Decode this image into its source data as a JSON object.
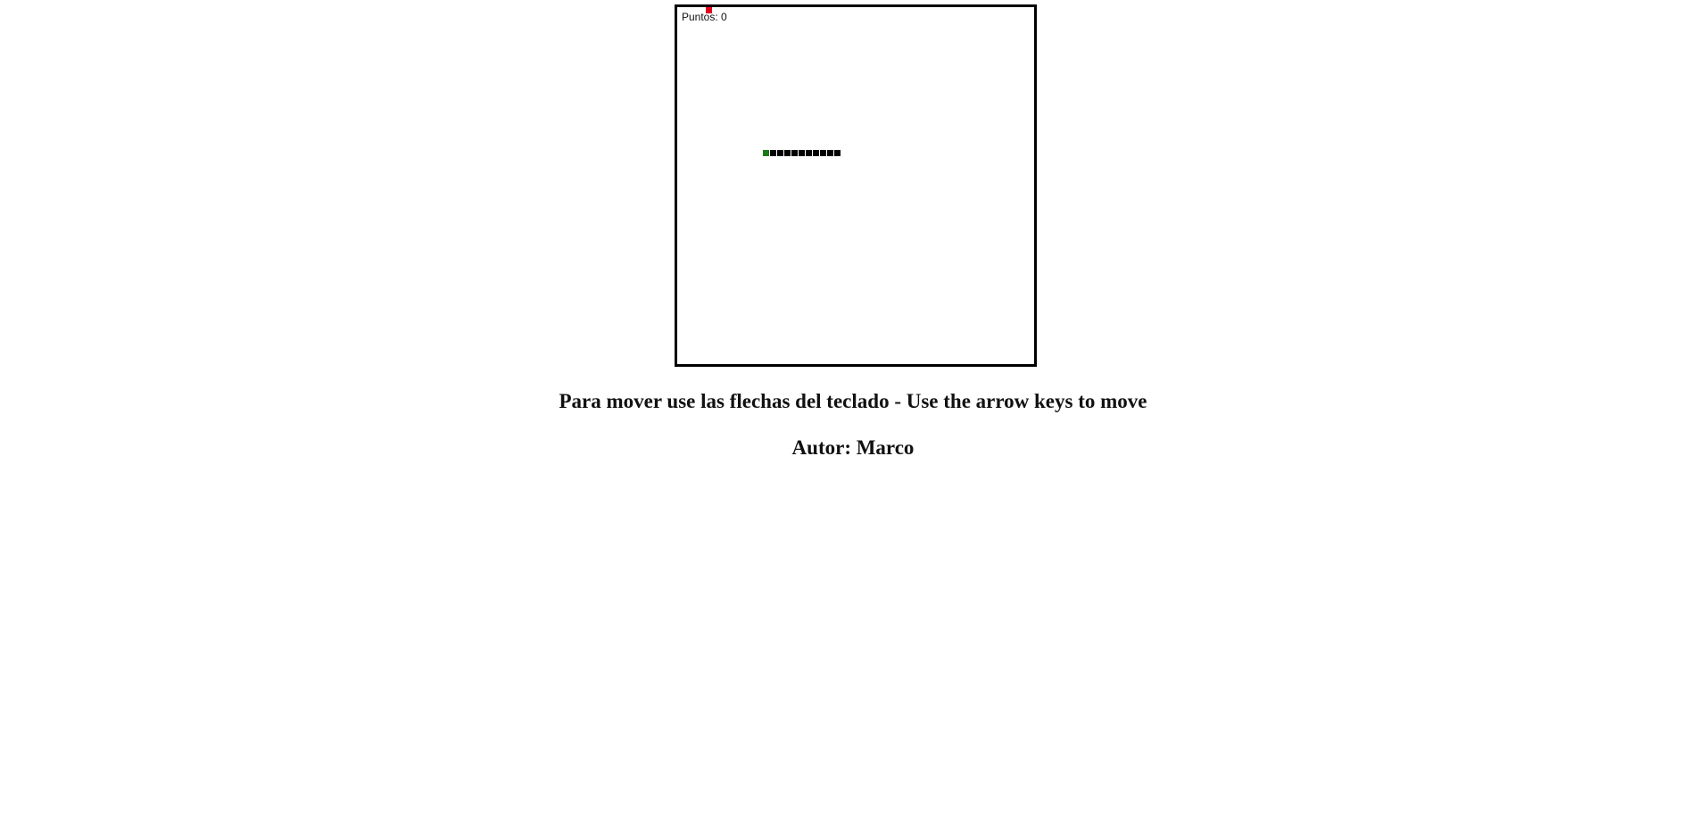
{
  "game": {
    "score_label": "Puntos",
    "score_value": "0",
    "grid_size": 50,
    "snake": {
      "head": [
        12,
        20
      ],
      "body": [
        [
          13,
          20
        ],
        [
          14,
          20
        ],
        [
          15,
          20
        ],
        [
          16,
          20
        ],
        [
          17,
          20
        ],
        [
          18,
          20
        ],
        [
          19,
          20
        ],
        [
          20,
          20
        ],
        [
          21,
          20
        ],
        [
          22,
          20
        ]
      ],
      "head_color": "#1a7a1a",
      "body_color": "#000000"
    },
    "food": {
      "cell": [
        4,
        0
      ],
      "color": "#e0001a"
    }
  },
  "instructions": "Para mover use las flechas del teclado - Use the arrow keys to move",
  "author": "Autor: Marco"
}
